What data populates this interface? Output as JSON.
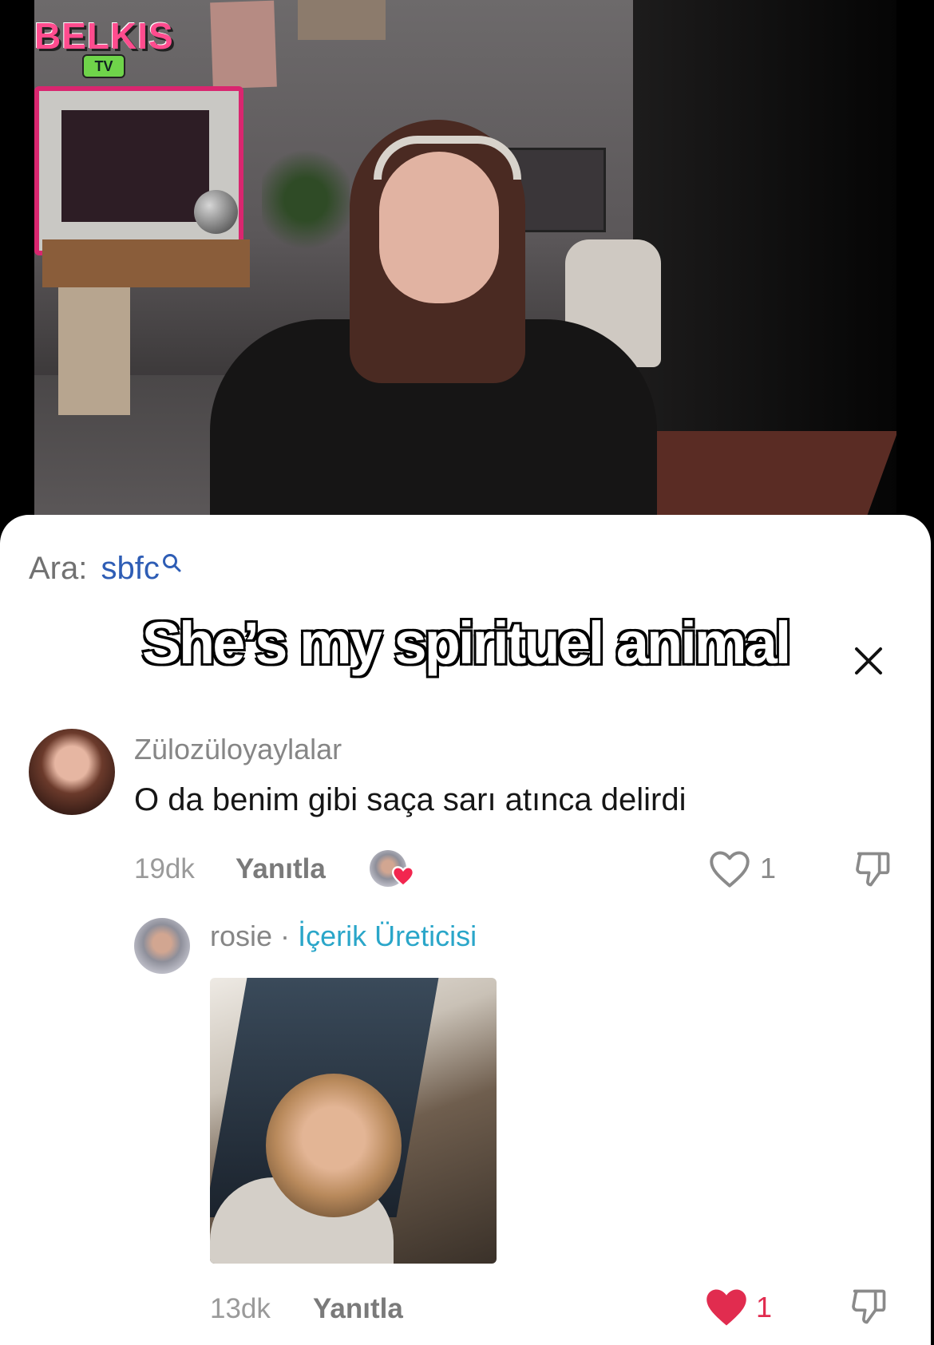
{
  "video": {
    "logo_text": "BELKIS",
    "logo_sub": "TV"
  },
  "search": {
    "prefix": "Ara:",
    "term": "sbfc"
  },
  "caption": "She’s my spirituel animal",
  "comments": [
    {
      "username": "Zülozüloyaylalar",
      "text": "O da benim gibi saça sarı atınca delirdi",
      "time": "19dk",
      "reply_label": "Yanıtla",
      "like_count": "1",
      "liked_by_creator": true
    }
  ],
  "replies": [
    {
      "username": "rosie",
      "separator": "·",
      "badge": "İçerik Üreticisi",
      "time": "13dk",
      "reply_label": "Yanıtla",
      "like_count": "1",
      "liked": true
    }
  ],
  "colors": {
    "accent_blue": "#2e5db5",
    "creator_badge": "#2aa6c9",
    "like_red": "#e12c4f"
  }
}
